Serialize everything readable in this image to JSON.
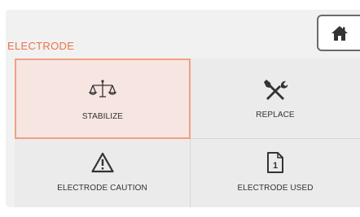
{
  "header": {
    "section_title": "ELECTRODE",
    "home_icon": "home-icon"
  },
  "tiles": [
    {
      "label": "STABILIZE",
      "icon": "balance-scale-icon",
      "selected": true
    },
    {
      "label": "REPLACE",
      "icon": "wrench-screwdriver-icon",
      "selected": false
    },
    {
      "label": "ELECTRODE CAUTION",
      "icon": "warning-triangle-icon",
      "selected": false
    },
    {
      "label": "ELECTRODE USED",
      "icon": "document-number-icon",
      "icon_text": "1",
      "selected": false
    }
  ],
  "colors": {
    "accent": "#e9734a",
    "selected_bg": "#f7e5e1",
    "selected_border": "#f0a083",
    "panel_bg": "#f1f1f1"
  }
}
